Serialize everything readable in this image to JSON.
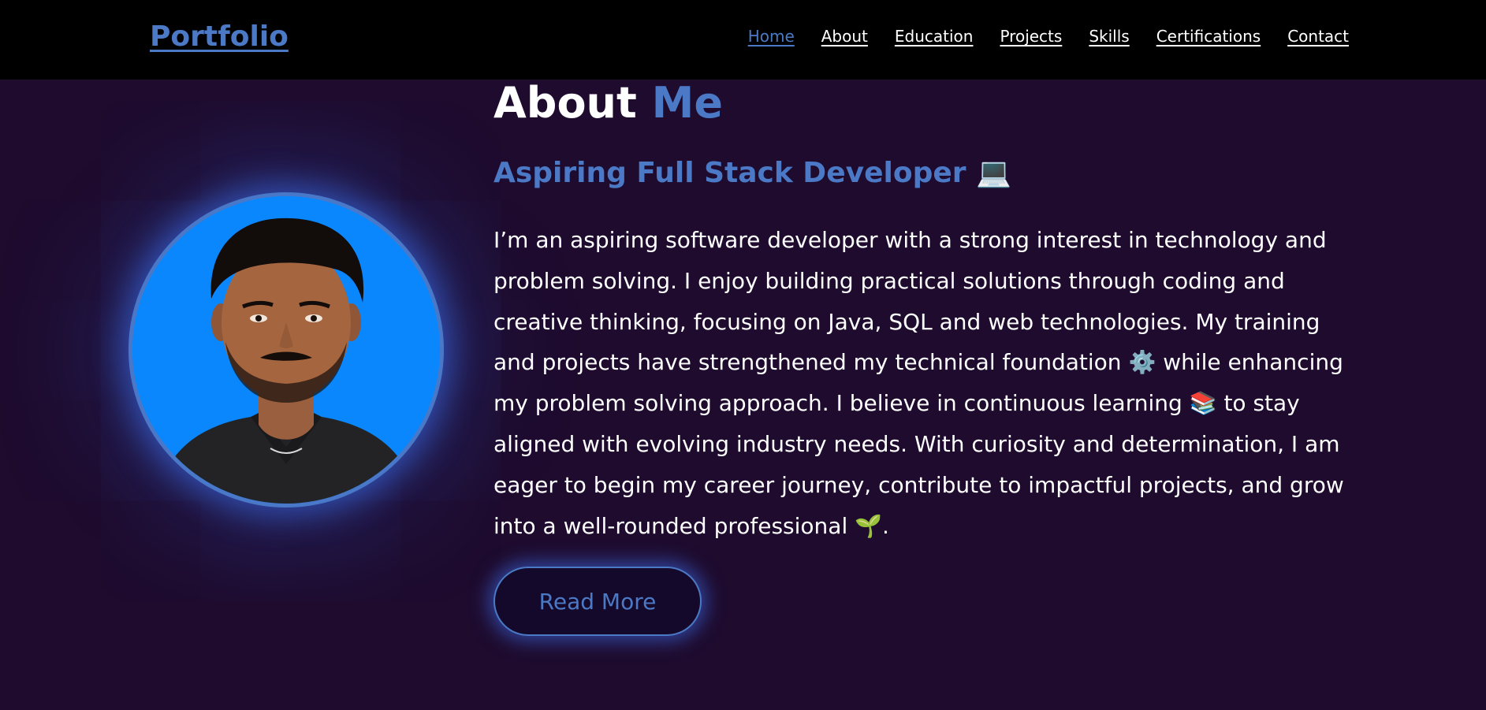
{
  "nav": {
    "logo": "Portfolio",
    "links": [
      {
        "label": "Home",
        "active": true
      },
      {
        "label": "About"
      },
      {
        "label": "Education"
      },
      {
        "label": "Projects"
      },
      {
        "label": "Skills"
      },
      {
        "label": "Certifications"
      },
      {
        "label": "Contact"
      }
    ]
  },
  "about": {
    "title_main": "About",
    "title_accent": "Me",
    "subtitle": "Aspiring Full Stack Developer",
    "subtitle_emoji": "💻",
    "bio": "I’m an aspiring software developer with a strong interest in technology and problem solving. I enjoy building practical solutions through coding and creative thinking, focusing on Java, SQL and web technologies. My training and projects have strengthened my technical foundation ⚙️ while enhancing my problem solving approach. I believe in continuous learning 📚 to stay aligned with evolving industry needs. With curiosity and determination, I am eager to begin my career journey, contribute to impactful projects, and grow into a well-rounded professional 🌱.",
    "button_label": "Read More"
  },
  "colors": {
    "background": "#1e0b2e",
    "navbar": "#000000",
    "accent": "#4b79c5",
    "photo_background": "#0a87fd"
  },
  "icons": {
    "profile_photo": "person-portrait"
  }
}
